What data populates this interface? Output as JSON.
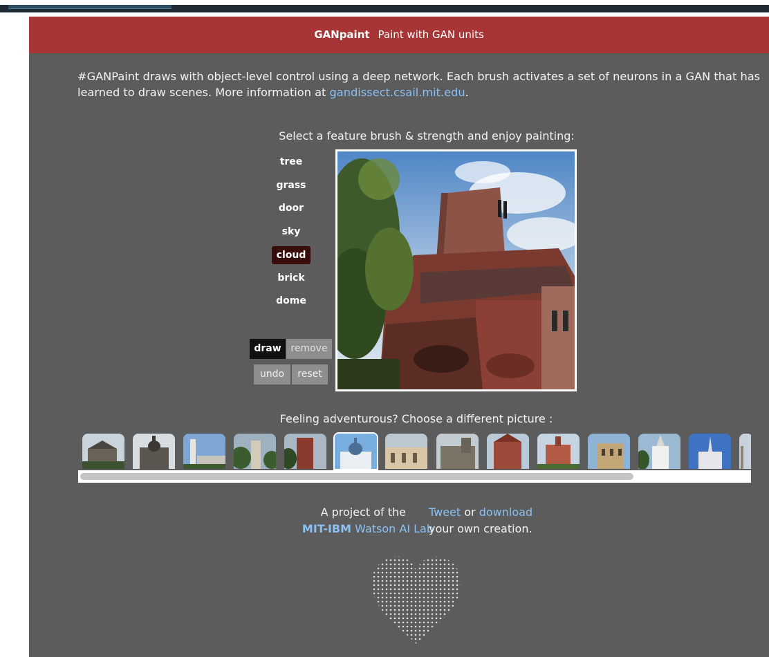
{
  "header": {
    "brand": "GANpaint",
    "tagline": "Paint with GAN units"
  },
  "intro": {
    "text": "#GANPaint draws with object-level control using a deep network. Each brush activates a set of neurons in a GAN that has learned to draw scenes. More information at ",
    "link": "gandissect.csail.mit.edu",
    "trailing": "."
  },
  "select_label": "Select a feature brush & strength and enjoy painting:",
  "brushes": [
    "tree",
    "grass",
    "door",
    "sky",
    "cloud",
    "brick",
    "dome"
  ],
  "selected_brush": "cloud",
  "modes": {
    "draw": "draw",
    "remove": "remove",
    "undo": "undo",
    "reset": "reset"
  },
  "feeling_label": "Feeling adventurous? Choose a different picture :",
  "gallery": {
    "thumbnail_count": 14,
    "selected_index": 5
  },
  "footer": {
    "project_of": "A project of the",
    "lab_bold": "MIT-IBM",
    "lab_rest": "Watson AI Lab",
    "tweet": "Tweet",
    "or": "or",
    "download": "download",
    "own_creation": "your own creation."
  },
  "colors": {
    "header_bg": "#a73535",
    "page_bg": "#5c5c5c",
    "link": "#8cc0f2",
    "selected_brush_bg": "#3a0d0d"
  }
}
